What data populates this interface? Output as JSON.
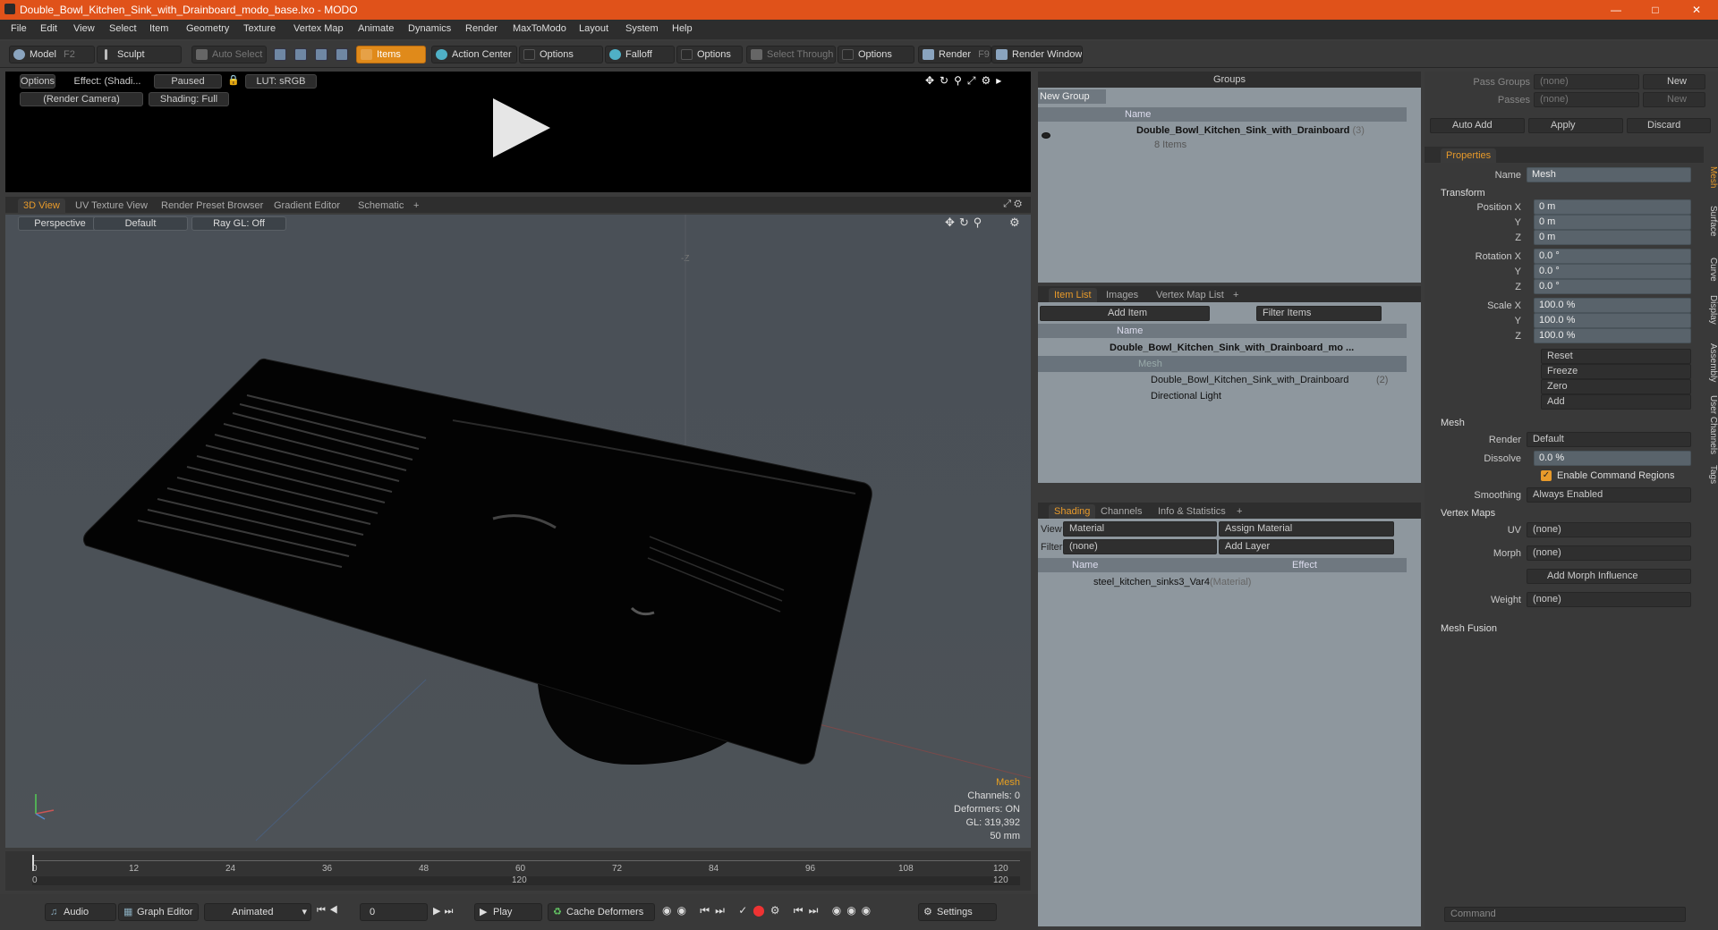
{
  "window": {
    "title": "Double_Bowl_Kitchen_Sink_with_Drainboard_modo_base.lxo - MODO"
  },
  "menu": [
    "File",
    "Edit",
    "View",
    "Select",
    "Item",
    "Geometry",
    "Texture",
    "Vertex Map",
    "Animate",
    "Dynamics",
    "Render",
    "MaxToModo",
    "Layout",
    "System",
    "Help"
  ],
  "toolbar": {
    "model": "Model",
    "model_key": "F2",
    "sculpt": "Sculpt",
    "auto_select": "Auto Select",
    "items": "Items",
    "action_center": "Action Center",
    "options1": "Options",
    "falloff": "Falloff",
    "options2": "Options",
    "select_through": "Select Through",
    "options3": "Options",
    "render": "Render",
    "render_key": "F9",
    "render_window": "Render Window"
  },
  "preview": {
    "options": "Options",
    "effect": "Effect: (Shadi...",
    "paused": "Paused",
    "lut": "LUT: sRGB",
    "camera": "(Render Camera)",
    "shading": "Shading: Full"
  },
  "viewport_tabs": [
    "3D View",
    "UV Texture View",
    "Render Preset Browser",
    "Gradient Editor",
    "Schematic",
    "+"
  ],
  "viewport": {
    "perspective": "Perspective",
    "default": "Default",
    "raygl": "Ray GL: Off",
    "axis_label": "-Z",
    "hud": {
      "selection": "Mesh",
      "channels": "Channels: 0",
      "deformers": "Deformers: ON",
      "gl": "GL: 319,392",
      "focal": "50 mm"
    }
  },
  "timeline": {
    "ticks": [
      "0",
      "12",
      "24",
      "36",
      "48",
      "60",
      "72",
      "84",
      "96",
      "108",
      "120"
    ],
    "sub_left": "0",
    "sub_mid": "120",
    "sub_right": "120"
  },
  "bottombar": {
    "audio": "Audio",
    "graph_editor": "Graph Editor",
    "animated": "Animated",
    "frame": "0",
    "play": "Play",
    "cache_deformers": "Cache Deformers",
    "settings": "Settings"
  },
  "groups": {
    "title": "Groups",
    "new_group": "New Group",
    "col_name": "Name",
    "item": "Double_Bowl_Kitchen_Sink_with_Drainboard",
    "item_count": "(3)",
    "item_sub": "8 Items"
  },
  "itemlist": {
    "tabs": [
      "Item List",
      "Images",
      "Vertex Map List",
      "+"
    ],
    "add_item": "Add Item",
    "filter": "Filter Items",
    "col_name": "Name",
    "rows": [
      {
        "name": "Double_Bowl_Kitchen_Sink_with_Drainboard_mo ..."
      },
      {
        "name": "Mesh"
      },
      {
        "name": "Double_Bowl_Kitchen_Sink_with_Drainboard",
        "count": "(2)"
      },
      {
        "name": "Directional Light"
      }
    ]
  },
  "shading": {
    "tabs": [
      "Shading",
      "Channels",
      "Info & Statistics",
      "+"
    ],
    "view_label": "View",
    "view_value": "Material",
    "assign": "Assign Material",
    "filter_label": "Filter",
    "filter_value": "(none)",
    "add_layer": "Add Layer",
    "col_name": "Name",
    "col_effect": "Effect",
    "row": "steel_kitchen_sinks3_Var4",
    "row_type": "(Material)"
  },
  "pass": {
    "pass_groups": "Pass Groups",
    "passes": "Passes",
    "none": "(none)",
    "new": "New",
    "auto_add": "Auto Add",
    "apply": "Apply",
    "discard": "Discard"
  },
  "properties": {
    "tab": "Properties",
    "name_label": "Name",
    "name_value": "Mesh",
    "transform": "Transform",
    "pos_label": "Position X",
    "rot_label": "Rotation X",
    "scale_label": "Scale X",
    "y": "Y",
    "z": "Z",
    "pos": [
      "0 m",
      "0 m",
      "0 m"
    ],
    "rot": [
      "0.0 °",
      "0.0 °",
      "0.0 °"
    ],
    "scale": [
      "100.0 %",
      "100.0 %",
      "100.0 %"
    ],
    "reset": "Reset",
    "freeze": "Freeze",
    "zero": "Zero",
    "add": "Add",
    "mesh": "Mesh",
    "render_label": "Render",
    "render_value": "Default",
    "dissolve_label": "Dissolve",
    "dissolve_value": "0.0 %",
    "enable_cmd": "Enable Command Regions",
    "smoothing_label": "Smoothing",
    "smoothing_value": "Always Enabled",
    "vertex_maps": "Vertex Maps",
    "uv_label": "UV",
    "uv_value": "(none)",
    "morph_label": "Morph",
    "morph_value": "(none)",
    "add_morph": "Add Morph Influence",
    "weight_label": "Weight",
    "weight_value": "(none)",
    "mesh_fusion": "Mesh Fusion",
    "side_tabs": [
      "Mesh",
      "Surface",
      "Curve",
      "Display",
      "Assembly",
      "User Channels",
      "Tags"
    ]
  },
  "command": {
    "placeholder": "Command"
  },
  "colors": {
    "title_bar": "#e0521a",
    "accent": "#e89a2a",
    "panel_bg": "#8e979e"
  }
}
